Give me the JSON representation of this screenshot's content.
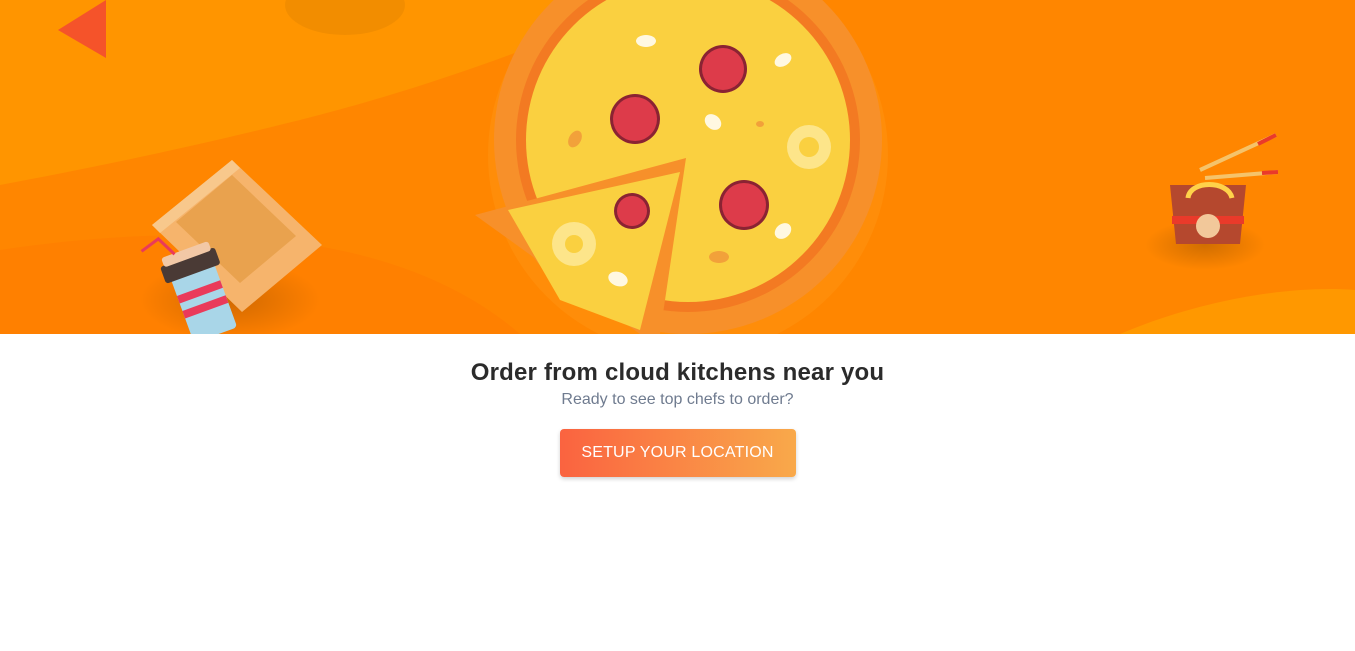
{
  "banner": {
    "illustration": "food-delivery-illustration",
    "colors": {
      "background": "#ff8800",
      "pizza_crust": "#f7902a",
      "pizza_cheese": "#fad040",
      "pepperoni": "#dd3b4a"
    }
  },
  "main": {
    "title": "Order from cloud kitchens near you",
    "subtitle": "Ready to see top chefs to order?",
    "cta_label": "SETUP YOUR LOCATION"
  },
  "colors": {
    "cta_gradient_start": "#fa6340",
    "cta_gradient_end": "#f9a94a",
    "title": "#2b2b2b",
    "subtitle": "#6f7b8f"
  }
}
